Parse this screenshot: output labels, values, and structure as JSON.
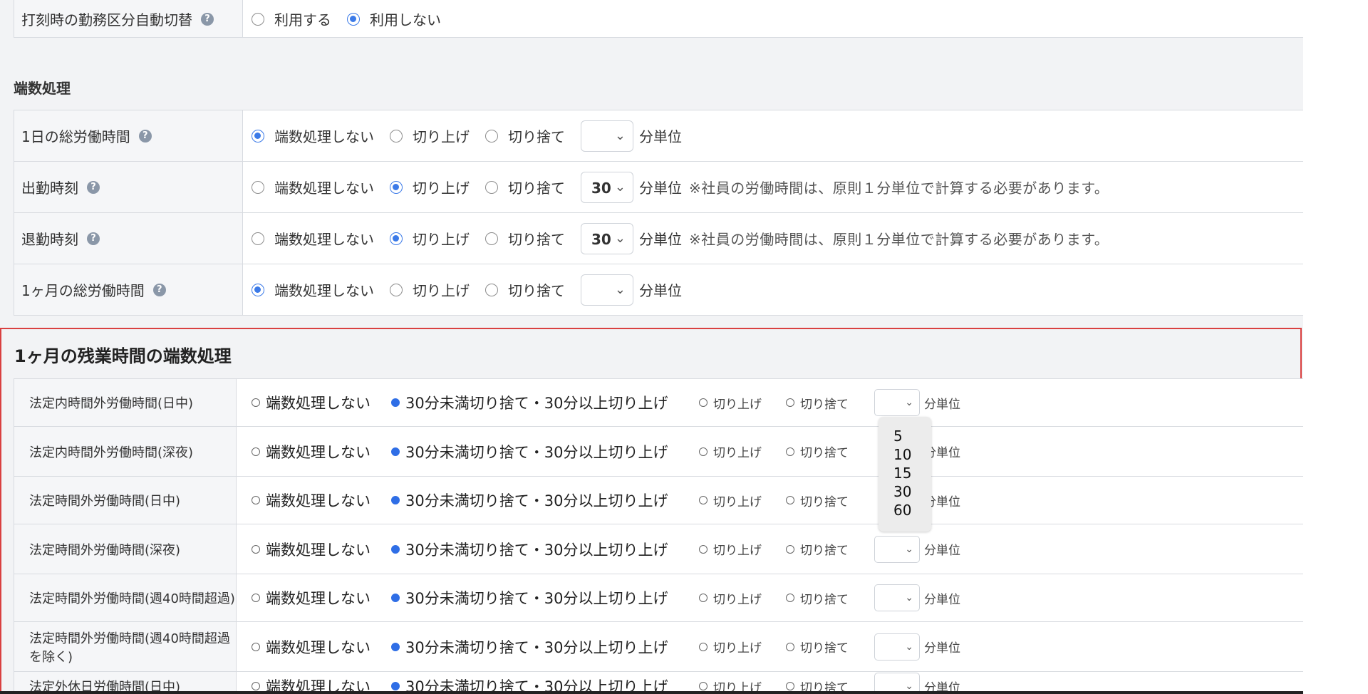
{
  "top_partial": {
    "label": "打刻時の勤務区分自動切替",
    "options": [
      "利用する",
      "利用しない"
    ],
    "selected": 1
  },
  "rounding_section": {
    "title": "端数処理",
    "rows": [
      {
        "label": "1日の総労働時間",
        "options": [
          "端数処理しない",
          "切り上げ",
          "切り捨て"
        ],
        "selected": 0,
        "select_value": "",
        "unit": "分単位",
        "note": ""
      },
      {
        "label": "出勤時刻",
        "options": [
          "端数処理しない",
          "切り上げ",
          "切り捨て"
        ],
        "selected": 1,
        "select_value": "30",
        "unit": "分単位",
        "note": "※社員の労働時間は、原則１分単位で計算する必要があります。"
      },
      {
        "label": "退勤時刻",
        "options": [
          "端数処理しない",
          "切り上げ",
          "切り捨て"
        ],
        "selected": 1,
        "select_value": "30",
        "unit": "分単位",
        "note": "※社員の労働時間は、原則１分単位で計算する必要があります。"
      },
      {
        "label": "1ヶ月の総労働時間",
        "options": [
          "端数処理しない",
          "切り上げ",
          "切り捨て"
        ],
        "selected": 0,
        "select_value": "",
        "unit": "分単位",
        "note": ""
      }
    ]
  },
  "overtime_section": {
    "title": "1ヶ月の残業時間の端数処理",
    "rows": [
      {
        "label": "法定内時間外労働時間(日中)"
      },
      {
        "label": "法定内時間外労働時間(深夜)"
      },
      {
        "label": "法定時間外労働時間(日中)"
      },
      {
        "label": "法定時間外労働時間(深夜)"
      },
      {
        "label": "法定時間外労働時間(週40時間超過)"
      },
      {
        "label": "法定時間外労働時間(週40時間超過を除く)"
      },
      {
        "label": "法定外休日労働時間(日中)"
      }
    ],
    "options": [
      "端数処理しない",
      "30分未満切り捨て・30分以上切り上げ",
      "切り上げ",
      "切り捨て"
    ],
    "selected": 1,
    "unit": "分単位"
  },
  "dropdown": {
    "options": [
      "5",
      "10",
      "15",
      "30",
      "60"
    ]
  },
  "colors": {
    "accent": "#3b7ae8",
    "highlight_border": "#d94040"
  }
}
